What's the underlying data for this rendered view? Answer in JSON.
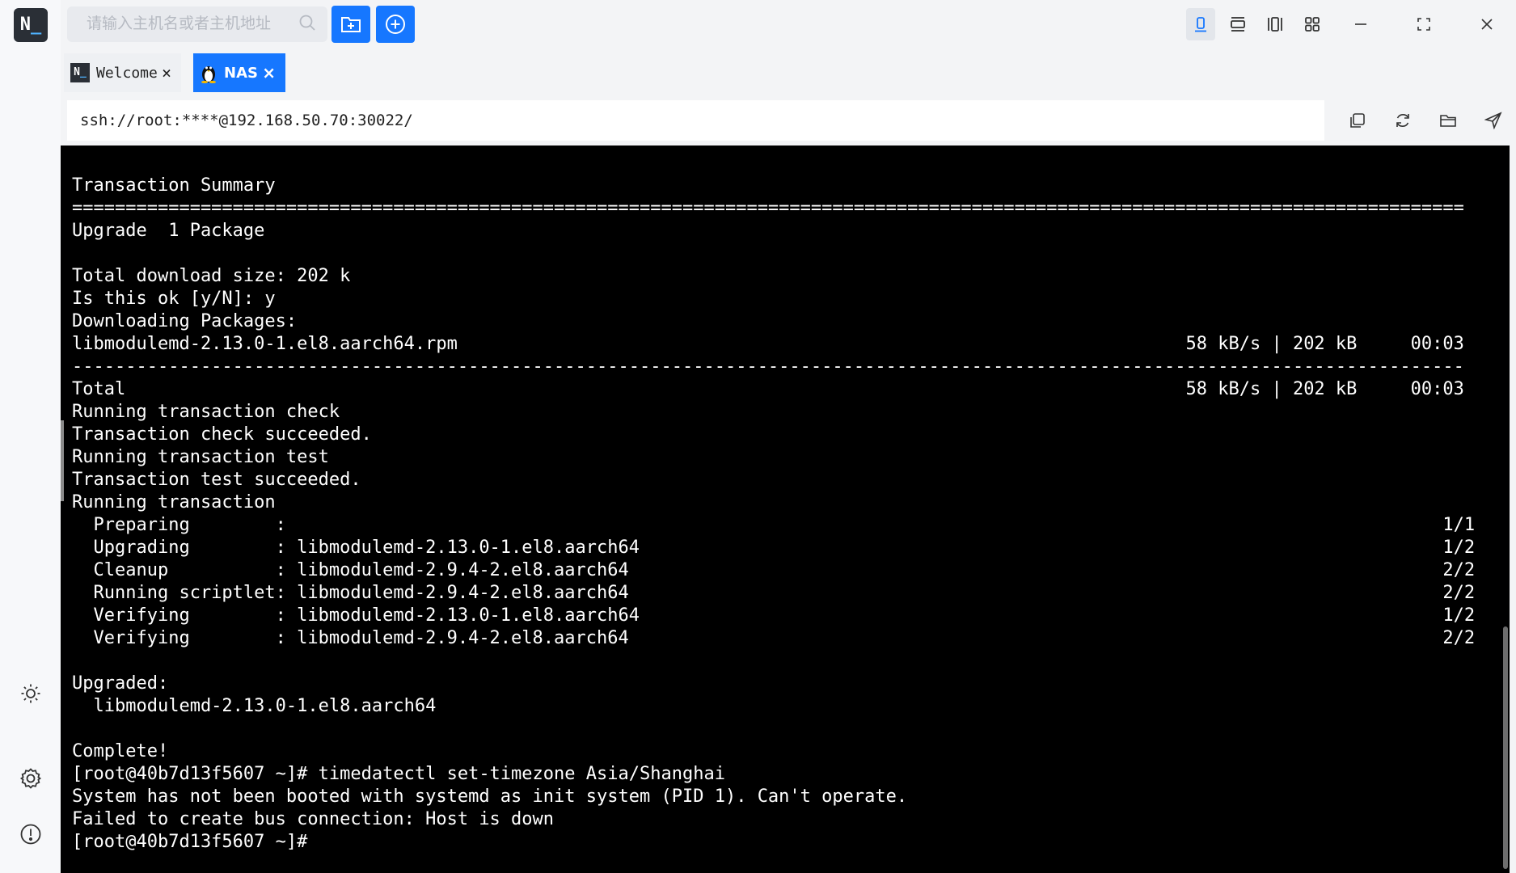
{
  "app": {
    "logo_text": "N_"
  },
  "search": {
    "placeholder": "请输入主机名或者主机地址"
  },
  "tabs": [
    {
      "label": "Welcome",
      "icon": "app-logo-icon"
    },
    {
      "label": "NAS",
      "icon": "linux-penguin-icon"
    }
  ],
  "address": {
    "value": "ssh://root:****@192.168.50.70:30022/"
  },
  "sidebar": {
    "icons": [
      "theme-sun-icon",
      "settings-gear-icon",
      "about-info-icon"
    ]
  },
  "colors": {
    "accent": "#1677ff",
    "terminal_bg": "#000000",
    "terminal_fg": "#ffffff"
  },
  "terminal": {
    "lines": [
      "Transaction Summary",
      "==================================================================================================================================",
      "Upgrade  1 Package",
      "",
      "Total download size: 202 k",
      "Is this ok [y/N]: y",
      "Downloading Packages:",
      "libmodulemd-2.13.0-1.el8.aarch64.rpm                                                                    58 kB/s | 202 kB     00:03",
      "----------------------------------------------------------------------------------------------------------------------------------",
      "Total                                                                                                   58 kB/s | 202 kB     00:03",
      "Running transaction check",
      "Transaction check succeeded.",
      "Running transaction test",
      "Transaction test succeeded.",
      "Running transaction",
      "  Preparing        :                                                                                                            1/1",
      "  Upgrading        : libmodulemd-2.13.0-1.el8.aarch64                                                                           1/2",
      "  Cleanup          : libmodulemd-2.9.4-2.el8.aarch64                                                                            2/2",
      "  Running scriptlet: libmodulemd-2.9.4-2.el8.aarch64                                                                            2/2",
      "  Verifying        : libmodulemd-2.13.0-1.el8.aarch64                                                                           1/2",
      "  Verifying        : libmodulemd-2.9.4-2.el8.aarch64                                                                            2/2",
      "",
      "Upgraded:",
      "  libmodulemd-2.13.0-1.el8.aarch64",
      "",
      "Complete!",
      "[root@40b7d13f5607 ~]# timedatectl set-timezone Asia/Shanghai",
      "System has not been booted with systemd as init system (PID 1). Can't operate.",
      "Failed to create bus connection: Host is down",
      "[root@40b7d13f5607 ~]#"
    ]
  }
}
